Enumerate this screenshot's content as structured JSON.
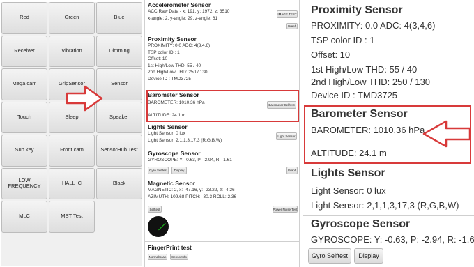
{
  "grid": [
    "Red",
    "Green",
    "Blue",
    "Receiver",
    "Vibration",
    "Dimming",
    "Mega cam",
    "GripSensor",
    "Sensor",
    "Touch",
    "Sleep",
    "Speaker",
    "Sub key",
    "Front cam",
    "SensorHub Test",
    "LOW FREQUENCY",
    "HALL IC",
    "Black",
    "MLC",
    "MST Test",
    ""
  ],
  "mid": {
    "accel": {
      "title": "Accelerometer Sensor",
      "line1": "ACC Raw Data - x: 191, y: 1972, z: 3510",
      "line2": "x-angle: 2, y-angle: 29, z-angle: 61",
      "btn_image": "IMAGE TEST",
      "btn_graph": "Graph"
    },
    "prox": {
      "title": "Proximity Sensor",
      "line1": "PROXIMITY: 0.0     ADC: 4(3,4,6)",
      "line2": "TSP color ID : 1",
      "line3": "Offset: 10",
      "line4": "1st High/Low THD: 55 / 40",
      "line5": "2nd High/Low THD: 250 / 130",
      "line6": "Device ID : TMD3725"
    },
    "baro": {
      "title": "Barometer Sensor",
      "line1": "BAROMETER: 1010.36 hPa",
      "line2": "ALTITUDE: 24.1 m",
      "btn": "Barometer Selftest"
    },
    "lights": {
      "title": "Lights Sensor",
      "line1": "Light Sensor: 0 lux",
      "line2": "Light Sensor: 2,1,1,3,17,3 (R,G,B,W)",
      "btn": "Light Sensor"
    },
    "gyro": {
      "title": "Gyroscope Sensor",
      "line1": "GYROSCOPE: Y: -0.63, P: -2.94, R: -1.61",
      "btn_selftest": "Gyro Selftest",
      "btn_display": "Display",
      "btn_graph": "Graph"
    },
    "mag": {
      "title": "Magnetic Sensor",
      "line1": "MAGNETIC: 2, x: -47.16, y: -23.22, z: -4.26",
      "line2": "AZIMUTH: 109.68   PITCH: -30.3   ROLL: 2.36",
      "btn_selftest": "Selftest",
      "btn_power": "Power Noise Test"
    },
    "finger": {
      "title": "FingerPrint test",
      "btn_normal": "NormalScan",
      "btn_info": "SensorInfo"
    }
  },
  "right": {
    "prox": {
      "title": "Proximity Sensor",
      "line1": "PROXIMITY: 0.0      ADC: 4(3,4,6)",
      "line2": "TSP color ID : 1",
      "line3": "Offset: 10",
      "line4": "1st High/Low THD: 55 / 40",
      "line5": "2nd High/Low THD: 250 / 130",
      "line6": "Device ID : TMD3725"
    },
    "baro": {
      "title": "Barometer Sensor",
      "line1": "BAROMETER: 1010.36 hPa",
      "line2": "ALTITUDE: 24.1 m"
    },
    "lights": {
      "title": "Lights Sensor",
      "line1": "Light Sensor: 0 lux",
      "line2": "Light Sensor: 2,1,1,3,17,3 (R,G,B,W)"
    },
    "gyro": {
      "title": "Gyroscope Sensor",
      "line1": "GYROSCOPE: Y: -0.63, P: -2.94, R: -1.6",
      "btn_selftest": "Gyro Selftest",
      "btn_display": "Display"
    }
  },
  "colors": {
    "highlight": "#d83a3a",
    "compass_needle": "#1cc21c"
  }
}
